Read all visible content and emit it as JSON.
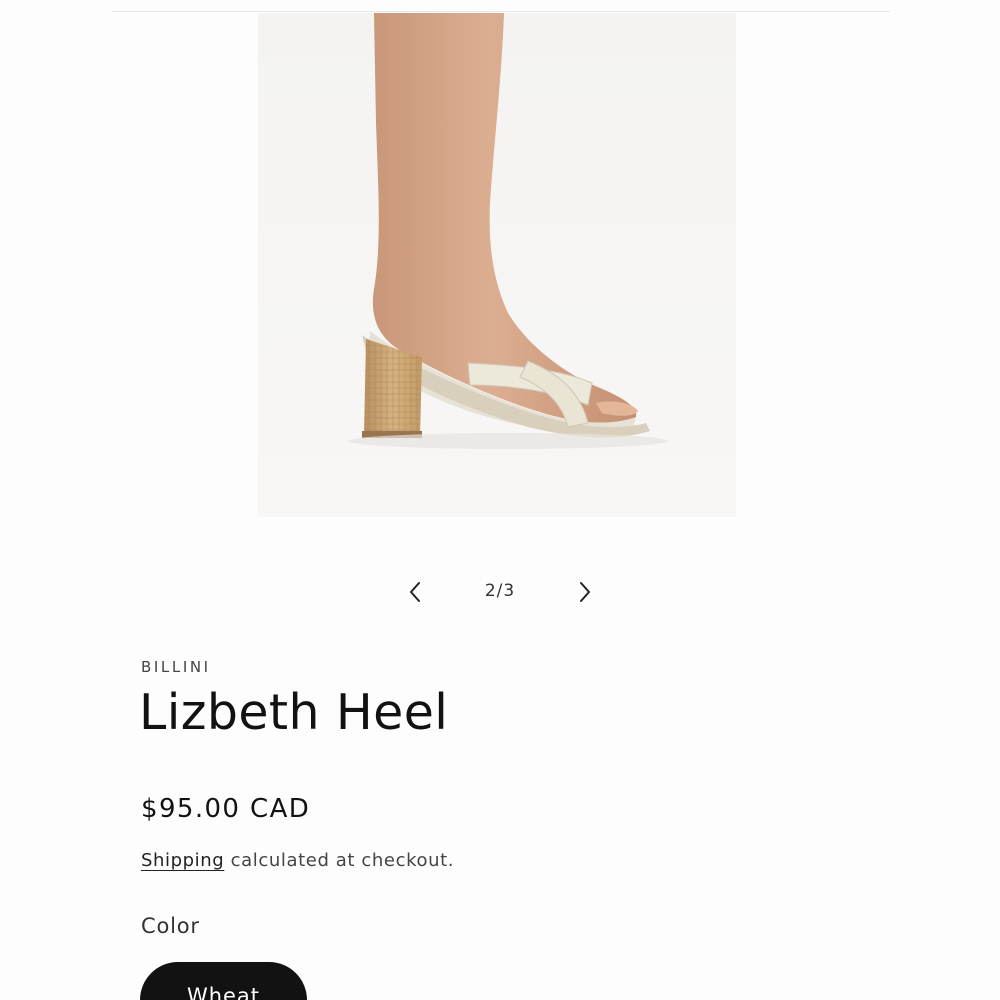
{
  "gallery": {
    "image_alt": "Lizbeth Heel",
    "counter": "2/3",
    "prev_icon": "chevron-left-icon",
    "next_icon": "chevron-right-icon"
  },
  "product": {
    "vendor": "BILLINI",
    "title": "Lizbeth Heel",
    "price": "$95.00 CAD",
    "shipping_link": "Shipping",
    "shipping_rest": " calculated at checkout.",
    "option_label": "Color",
    "option_value": "Wheat"
  }
}
